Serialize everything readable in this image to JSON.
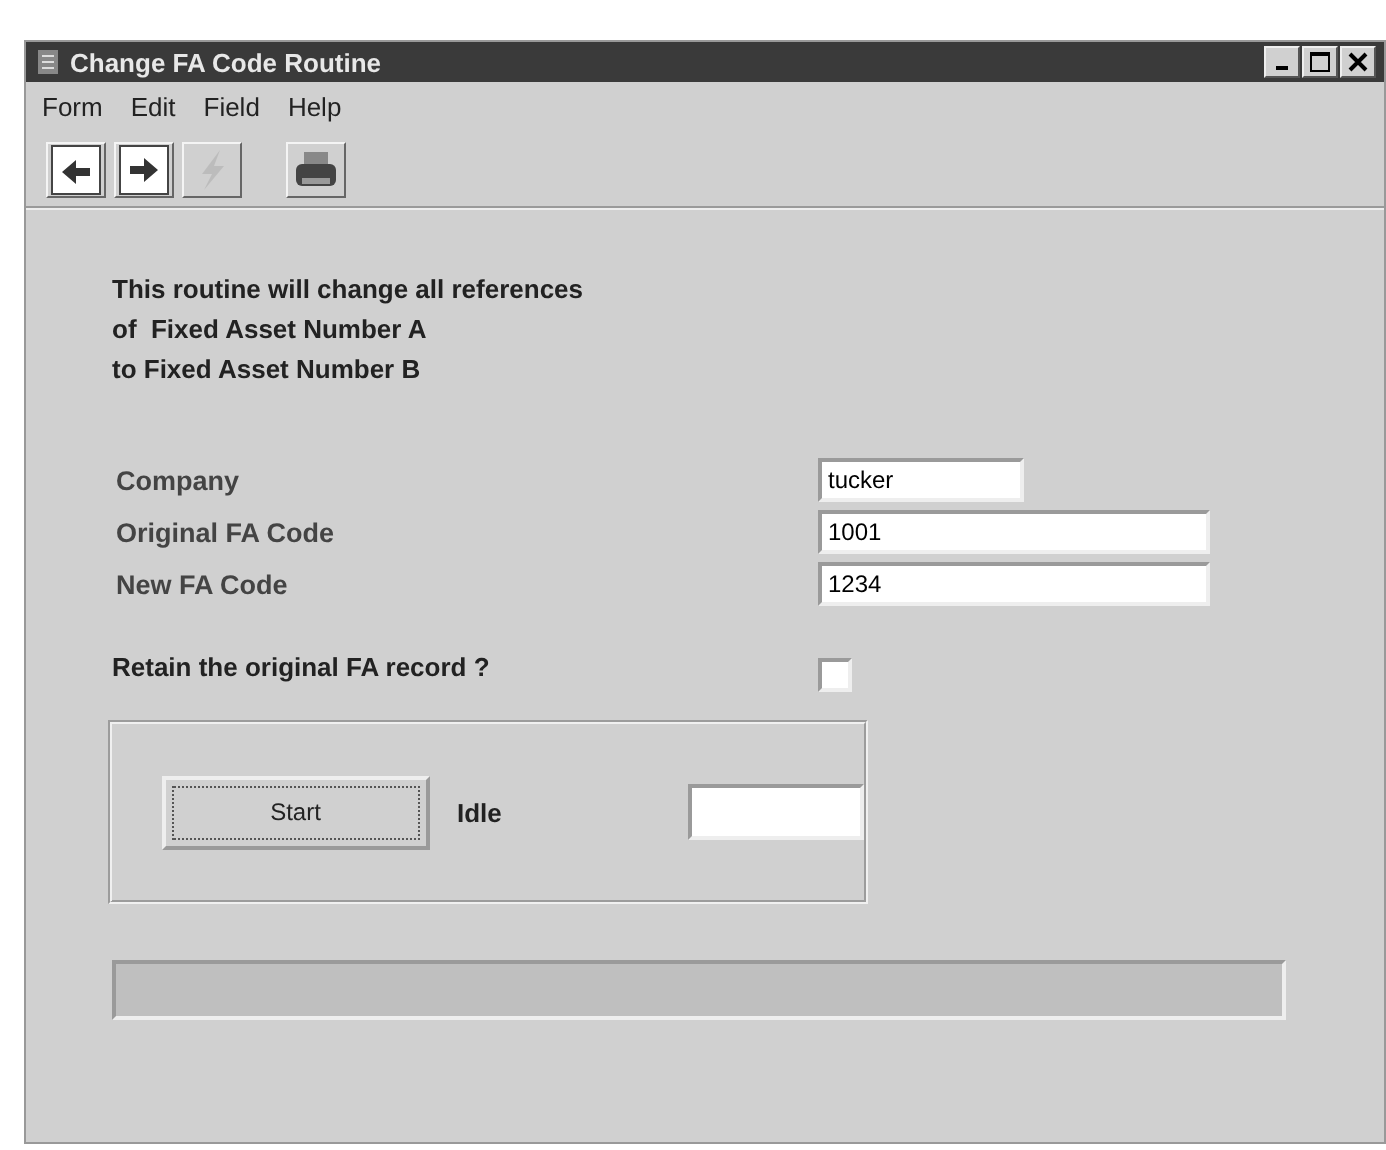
{
  "window": {
    "title": "Change FA Code Routine"
  },
  "menu": [
    "Form",
    "Edit",
    "Field",
    "Help"
  ],
  "toolbar": [
    {
      "kind": "doc-in",
      "disabled": false
    },
    {
      "kind": "doc-out",
      "disabled": false
    },
    {
      "kind": "lightning",
      "disabled": true
    },
    {
      "kind": "printer",
      "disabled": false
    }
  ],
  "description": [
    "This routine will change all references",
    "of  Fixed Asset Number A",
    "to Fixed Asset Number B"
  ],
  "fields": [
    {
      "label": "Company",
      "value": "tucker",
      "kind": "short"
    },
    {
      "label": "Original FA Code",
      "value": "1001",
      "kind": "long"
    },
    {
      "label": "New FA Code",
      "value": "1234",
      "kind": "long"
    }
  ],
  "retain": {
    "label": "Retain the original FA record ?",
    "checked": false
  },
  "run": {
    "button": "Start",
    "status": "Idle"
  }
}
